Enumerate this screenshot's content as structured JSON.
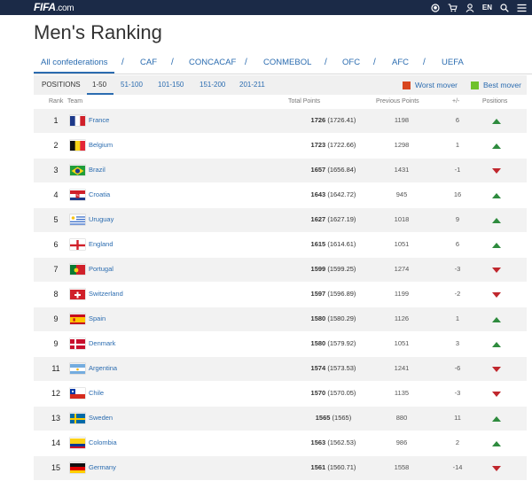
{
  "header": {
    "logo_main": "FIFA",
    "logo_suffix": ".com",
    "lang": "EN",
    "icons": [
      "ball-icon",
      "cart-icon",
      "user-icon",
      "search-icon",
      "menu-icon"
    ]
  },
  "page_title": "Men's Ranking",
  "confederations": [
    "All confederations",
    "CAF",
    "CONCACAF",
    "CONMEBOL",
    "OFC",
    "AFC",
    "UEFA"
  ],
  "conf_separator": "/",
  "positions": {
    "label": "POSITIONS",
    "ranges": [
      "1-50",
      "51-100",
      "101-150",
      "151-200",
      "201-211"
    ],
    "active": "1-50"
  },
  "legend": {
    "worst": "Worst mover",
    "best": "Best mover",
    "worst_color": "#d8461f",
    "best_color": "#6fc22c"
  },
  "columns": {
    "rank": "Rank",
    "team": "Team",
    "total": "Total Points",
    "previous": "Previous Points",
    "change": "+/-",
    "positions": "Positions"
  },
  "colors": {
    "up": "#2e8b3e",
    "down": "#c0272d",
    "link": "#2b6cb0"
  },
  "rows": [
    {
      "rank": "1",
      "team": "France",
      "pts": "1726",
      "pts_exact": "(1726.41)",
      "prev": "1198",
      "chg": "6",
      "dir": "up",
      "flag": "france-flag"
    },
    {
      "rank": "2",
      "team": "Belgium",
      "pts": "1723",
      "pts_exact": "(1722.66)",
      "prev": "1298",
      "chg": "1",
      "dir": "up",
      "flag": "belgium-flag"
    },
    {
      "rank": "3",
      "team": "Brazil",
      "pts": "1657",
      "pts_exact": "(1656.84)",
      "prev": "1431",
      "chg": "-1",
      "dir": "down",
      "flag": "brazil-flag"
    },
    {
      "rank": "4",
      "team": "Croatia",
      "pts": "1643",
      "pts_exact": "(1642.72)",
      "prev": "945",
      "chg": "16",
      "dir": "up",
      "flag": "croatia-flag"
    },
    {
      "rank": "5",
      "team": "Uruguay",
      "pts": "1627",
      "pts_exact": "(1627.19)",
      "prev": "1018",
      "chg": "9",
      "dir": "up",
      "flag": "uruguay-flag"
    },
    {
      "rank": "6",
      "team": "England",
      "pts": "1615",
      "pts_exact": "(1614.61)",
      "prev": "1051",
      "chg": "6",
      "dir": "up",
      "flag": "england-flag"
    },
    {
      "rank": "7",
      "team": "Portugal",
      "pts": "1599",
      "pts_exact": "(1599.25)",
      "prev": "1274",
      "chg": "-3",
      "dir": "down",
      "flag": "portugal-flag"
    },
    {
      "rank": "8",
      "team": "Switzerland",
      "pts": "1597",
      "pts_exact": "(1596.89)",
      "prev": "1199",
      "chg": "-2",
      "dir": "down",
      "flag": "switzerland-flag"
    },
    {
      "rank": "9",
      "team": "Spain",
      "pts": "1580",
      "pts_exact": "(1580.29)",
      "prev": "1126",
      "chg": "1",
      "dir": "up",
      "flag": "spain-flag"
    },
    {
      "rank": "9",
      "team": "Denmark",
      "pts": "1580",
      "pts_exact": "(1579.92)",
      "prev": "1051",
      "chg": "3",
      "dir": "up",
      "flag": "denmark-flag"
    },
    {
      "rank": "11",
      "team": "Argentina",
      "pts": "1574",
      "pts_exact": "(1573.53)",
      "prev": "1241",
      "chg": "-6",
      "dir": "down",
      "flag": "argentina-flag"
    },
    {
      "rank": "12",
      "team": "Chile",
      "pts": "1570",
      "pts_exact": "(1570.05)",
      "prev": "1135",
      "chg": "-3",
      "dir": "down",
      "flag": "chile-flag"
    },
    {
      "rank": "13",
      "team": "Sweden",
      "pts": "1565",
      "pts_exact": "(1565)",
      "prev": "880",
      "chg": "11",
      "dir": "up",
      "flag": "sweden-flag"
    },
    {
      "rank": "14",
      "team": "Colombia",
      "pts": "1563",
      "pts_exact": "(1562.53)",
      "prev": "986",
      "chg": "2",
      "dir": "up",
      "flag": "colombia-flag"
    },
    {
      "rank": "15",
      "team": "Germany",
      "pts": "1561",
      "pts_exact": "(1560.71)",
      "prev": "1558",
      "chg": "-14",
      "dir": "down",
      "flag": "germany-flag"
    }
  ]
}
